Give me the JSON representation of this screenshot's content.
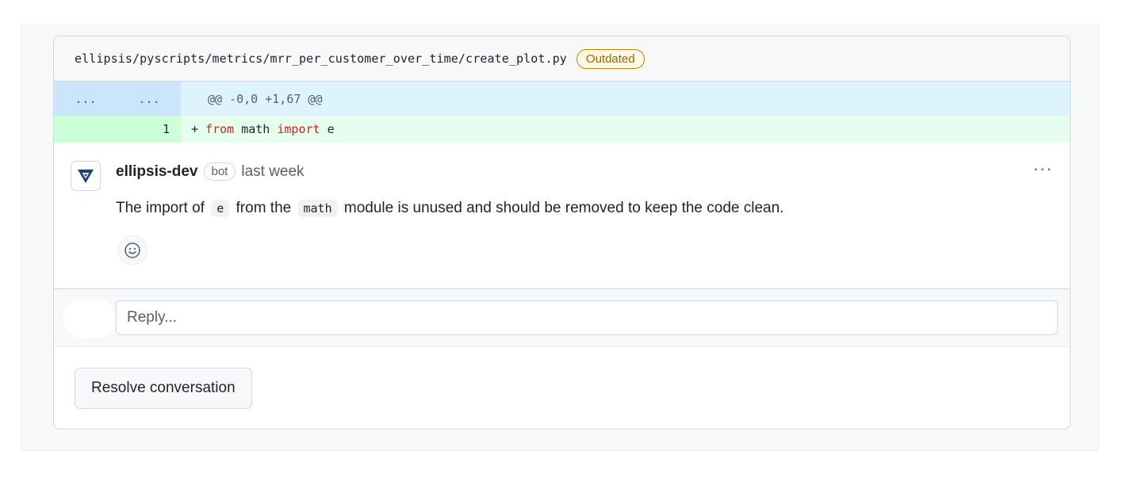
{
  "file": {
    "path": "ellipsis/pyscripts/metrics/mrr_per_customer_over_time/create_plot.py",
    "status_badge": "Outdated"
  },
  "diff": {
    "hunk": {
      "old_marker": "...",
      "new_marker": "...",
      "header": "@@ -0,0 +1,67 @@"
    },
    "lines": [
      {
        "old_num": "",
        "new_num": "1",
        "sign": "+",
        "tokens": [
          {
            "text": "from",
            "kind": "keyword"
          },
          {
            "text": " math ",
            "kind": "plain"
          },
          {
            "text": "import",
            "kind": "keyword"
          },
          {
            "text": " e",
            "kind": "plain"
          }
        ]
      }
    ]
  },
  "comment": {
    "author": "ellipsis-dev",
    "author_badge": "bot",
    "timestamp": "last week",
    "menu_glyph": "···",
    "body": {
      "part1": "The import of ",
      "code1": "e",
      "part2": " from the ",
      "code2": "math",
      "part3": " module is unused and should be removed to keep the code clean."
    },
    "reaction_icon": "smiley-icon"
  },
  "reply": {
    "placeholder": "Reply..."
  },
  "actions": {
    "resolve_label": "Resolve conversation"
  },
  "colors": {
    "keyword": "#cf222e",
    "outdated_border": "#bf8700",
    "outdated_text": "#9a6700",
    "hunk_bg": "#ddf4ff",
    "addition_bg": "#e6ffec",
    "avatar_brand": "#1b3f72"
  }
}
